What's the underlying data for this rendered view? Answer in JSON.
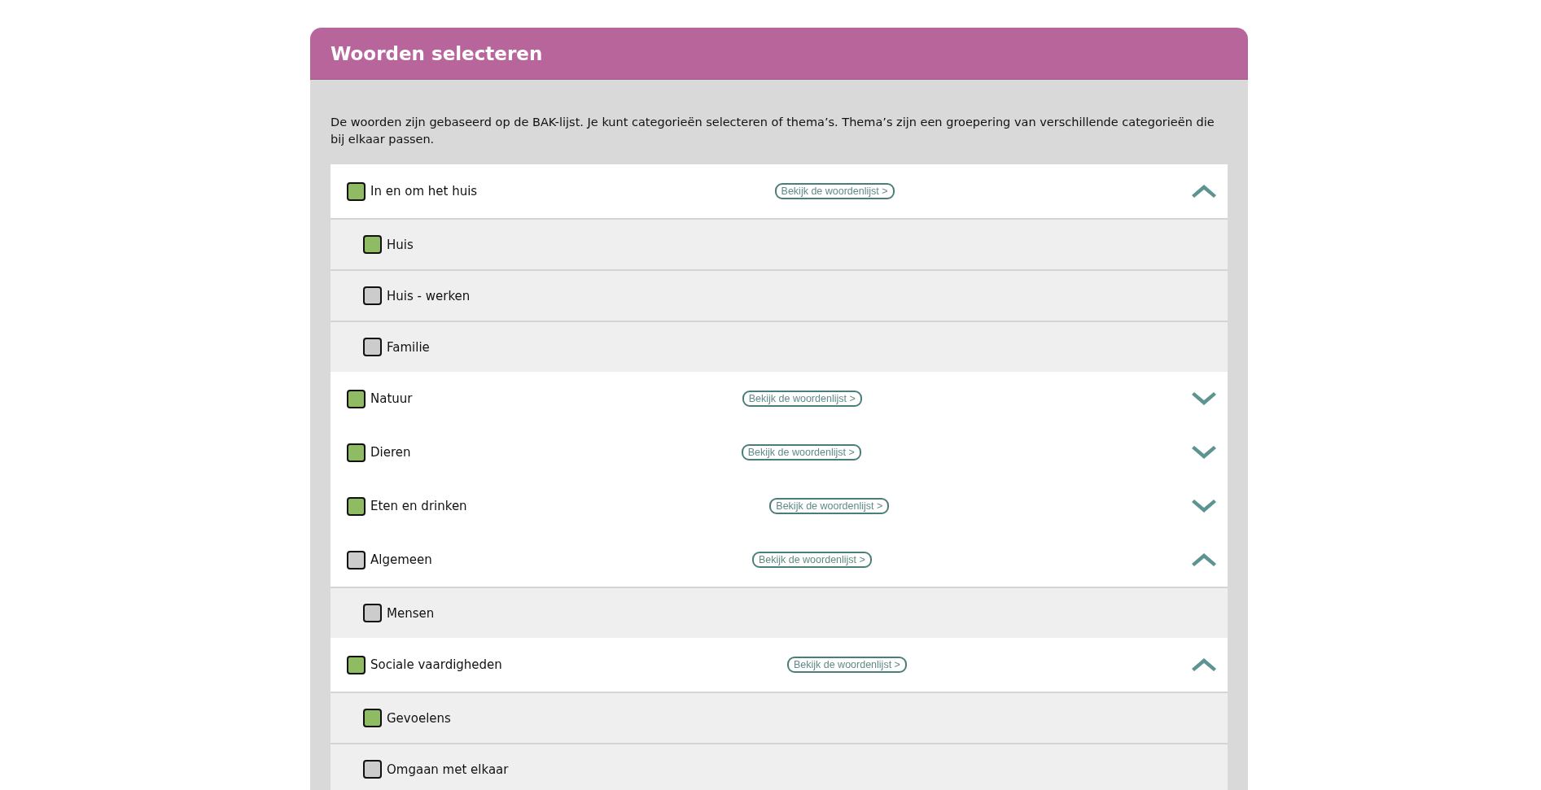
{
  "panel": {
    "title": "Woorden selecteren",
    "intro": "De woorden zijn gebaseerd op de BAK-lijst. Je kunt categorieën selecteren of thema’s. Thema’s zijn een groepering van verschillende categorieën die bij elkaar passen."
  },
  "themes": [
    {
      "label": "In en om het huis",
      "checked": true,
      "link": "Bekijk de woordenlijst >",
      "expanded": true,
      "children": [
        {
          "label": "Huis",
          "checked": true
        },
        {
          "label": "Huis - werken",
          "checked": false
        },
        {
          "label": "Familie",
          "checked": false
        }
      ]
    },
    {
      "label": "Natuur",
      "checked": true,
      "link": "Bekijk de woordenlijst >",
      "expanded": false
    },
    {
      "label": "Dieren",
      "checked": true,
      "link": "Bekijk de woordenlijst >",
      "expanded": false
    },
    {
      "label": "Eten en drinken",
      "checked": true,
      "link": "Bekijk de woordenlijst >",
      "expanded": false
    },
    {
      "label": "Algemeen",
      "checked": false,
      "link": "Bekijk de woordenlijst >",
      "expanded": true,
      "children": [
        {
          "label": "Mensen",
          "checked": false
        }
      ]
    },
    {
      "label": "Sociale vaardigheden",
      "checked": true,
      "link": "Bekijk de woordenlijst >",
      "expanded": true,
      "children": [
        {
          "label": "Gevoelens",
          "checked": true
        },
        {
          "label": "Omgaan met elkaar",
          "checked": false
        }
      ]
    }
  ]
}
